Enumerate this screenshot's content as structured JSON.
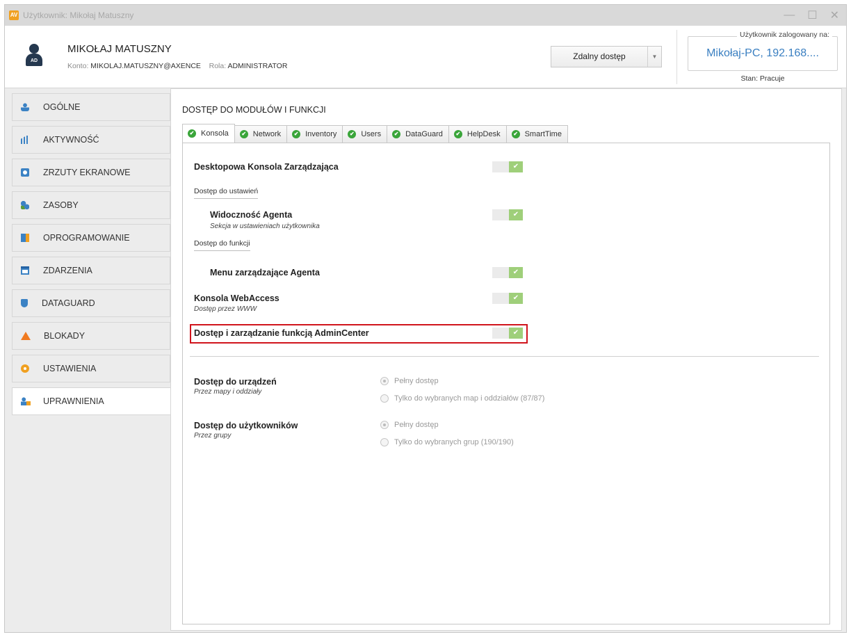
{
  "window": {
    "title": "Użytkownik: Mikołaj Matuszny",
    "app_icon": "AV",
    "controls": {
      "minimize": "—",
      "maximize": "☐",
      "close": "✕"
    }
  },
  "header": {
    "user_name": "MIKOŁAJ MATUSZNY",
    "avatar_badge": "AD",
    "account_label": "Konto:",
    "account_value": "MIKOLAJ.MATUSZNY@AXENCE",
    "role_label": "Rola:",
    "role_value": "ADMINISTRATOR",
    "remote_button": "Zdalny dostęp",
    "logged_caption": "Użytkownik zalogowany na:",
    "logged_value": "Mikołaj-PC, 192.168....",
    "status": "Stan: Pracuje"
  },
  "sidebar": {
    "items": [
      {
        "label": "OGÓLNE",
        "icon": "user-stats-icon"
      },
      {
        "label": "AKTYWNOŚĆ",
        "icon": "bar-chart-icon"
      },
      {
        "label": "ZRZUTY EKRANOWE",
        "icon": "camera-icon"
      },
      {
        "label": "ZASOBY",
        "icon": "resources-icon"
      },
      {
        "label": "OPROGRAMOWANIE",
        "icon": "software-icon"
      },
      {
        "label": "ZDARZENIA",
        "icon": "calendar-icon"
      },
      {
        "label": "DATAGUARD",
        "icon": "shield-icon"
      },
      {
        "label": "BLOKADY",
        "icon": "warning-icon"
      },
      {
        "label": "USTAWIENIA",
        "icon": "gear-icon"
      },
      {
        "label": "UPRAWNIENIA",
        "icon": "user-lock-icon",
        "active": true
      }
    ]
  },
  "content": {
    "title": "DOSTĘP DO MODUŁÓW I FUNKCJI",
    "tabs": [
      "Konsola",
      "Network",
      "Inventory",
      "Users",
      "DataGuard",
      "HelpDesk",
      "SmartTime"
    ],
    "active_tab": "Konsola",
    "check_glyph": "✔",
    "rows": {
      "desktop_console": "Desktopowa Konsola Zarządzająca",
      "settings_group": "Dostęp do ustawień",
      "agent_visibility": "Widoczność Agenta",
      "agent_visibility_sub": "Sekcja w ustawieniach użytkownika",
      "functions_group": "Dostęp do funkcji",
      "agent_menu": "Menu zarządzające Agenta",
      "webaccess": "Konsola WebAccess",
      "webaccess_sub": "Dostęp przez WWW",
      "admincenter": "Dostęp i zarządzanie funkcją AdminCenter"
    },
    "devices": {
      "label": "Dostęp do urządzeń",
      "sub": "Przez mapy i oddziały",
      "option_full": "Pełny dostęp",
      "option_selected": "Tylko do wybranych map i oddziałów (87/87)",
      "selected": "Pełny dostęp"
    },
    "users": {
      "label": "Dostęp do użytkowników",
      "sub": "Przez grupy",
      "option_full": "Pełny dostęp",
      "option_selected": "Tylko do wybranych grup (190/190)",
      "selected": "Pełny dostęp"
    }
  },
  "colors": {
    "accent": "#3a7fc1",
    "toggle_on": "#9fcf7a",
    "highlight": "#d0141c",
    "tab_check": "#3aa53a"
  }
}
